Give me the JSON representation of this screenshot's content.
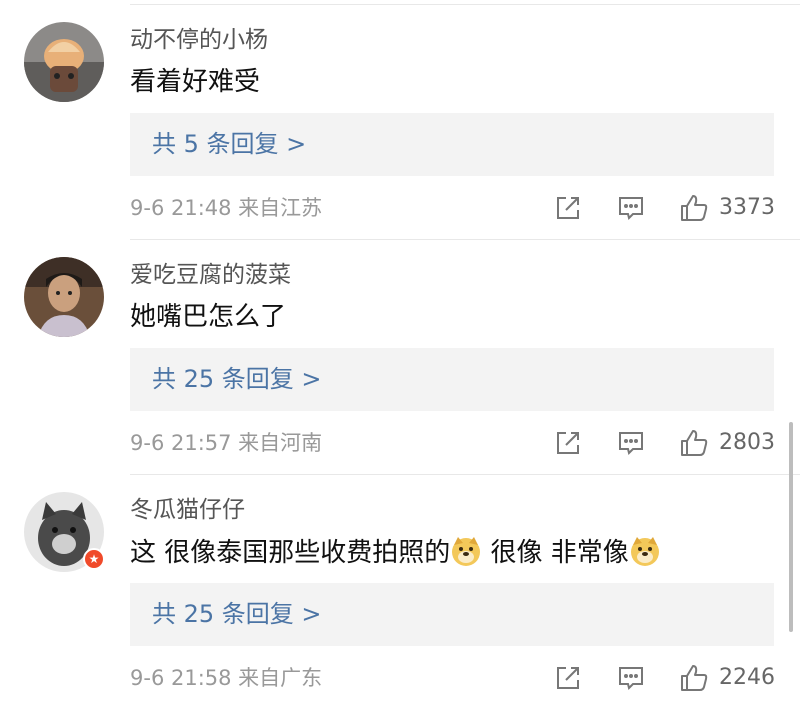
{
  "comments": [
    {
      "username": "动不停的小杨",
      "text": "看着好难受",
      "replies_label": "共 5 条回复 >",
      "meta": "9-6 21:48 来自江苏",
      "likes": "3373"
    },
    {
      "username": "爱吃豆腐的菠菜",
      "text": "她嘴巴怎么了",
      "replies_label": "共 25 条回复 >",
      "meta": "9-6 21:57 来自河南",
      "likes": "2803"
    },
    {
      "username": "冬瓜猫仔仔",
      "text_part1": "这 很像泰国那些收费拍照的",
      "text_part2": " 很像 非常像",
      "replies_label": "共 25 条回复 >",
      "meta": "9-6 21:58 来自广东",
      "likes": "2246"
    }
  ],
  "icons": [
    "share-icon",
    "comment-icon",
    "like-icon",
    "doge-emoji",
    "verified-badge"
  ],
  "colors": {
    "reply_link": "#4b74a5",
    "meta_text": "#999999",
    "reply_bg": "#f3f3f3",
    "badge": "#f04a2a"
  }
}
